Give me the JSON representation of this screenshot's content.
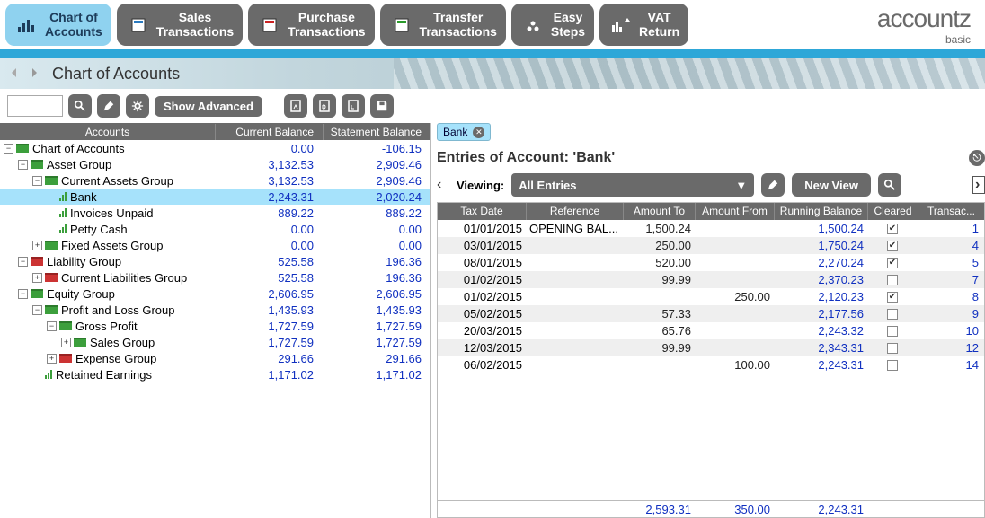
{
  "nav": {
    "items": [
      {
        "label": "Chart of\nAccounts",
        "active": true,
        "icon": "bars"
      },
      {
        "label": "Sales\nTransactions",
        "active": false,
        "icon": "doc-blue"
      },
      {
        "label": "Purchase\nTransactions",
        "active": false,
        "icon": "doc-red"
      },
      {
        "label": "Transfer\nTransactions",
        "active": false,
        "icon": "doc-green"
      },
      {
        "label": "Easy\nSteps",
        "active": false,
        "icon": "steps"
      },
      {
        "label": "VAT\nReturn",
        "active": false,
        "icon": "vat"
      }
    ]
  },
  "brand": {
    "main": "accountz",
    "sub": "basic"
  },
  "header": {
    "title": "Chart of Accounts"
  },
  "toolbar": {
    "show_advanced": "Show Advanced"
  },
  "tree": {
    "headers": {
      "accounts": "Accounts",
      "current": "Current Balance",
      "statement": "Statement Balance"
    },
    "rows": [
      {
        "indent": 0,
        "toggle": "-",
        "icon": "folder-green",
        "name": "Chart of Accounts",
        "current": "0.00",
        "statement": "-106.15"
      },
      {
        "indent": 1,
        "toggle": "-",
        "icon": "folder-green",
        "name": "Asset Group",
        "current": "3,132.53",
        "statement": "2,909.46"
      },
      {
        "indent": 2,
        "toggle": "-",
        "icon": "folder-green",
        "name": "Current Assets Group",
        "current": "3,132.53",
        "statement": "2,909.46"
      },
      {
        "indent": 3,
        "toggle": "",
        "icon": "bars",
        "name": "Bank",
        "current": "2,243.31",
        "statement": "2,020.24",
        "selected": true
      },
      {
        "indent": 3,
        "toggle": "",
        "icon": "bars",
        "name": "Invoices Unpaid",
        "current": "889.22",
        "statement": "889.22"
      },
      {
        "indent": 3,
        "toggle": "",
        "icon": "bars",
        "name": "Petty Cash",
        "current": "0.00",
        "statement": "0.00"
      },
      {
        "indent": 2,
        "toggle": "+",
        "icon": "folder-green",
        "name": "Fixed Assets Group",
        "current": "0.00",
        "statement": "0.00"
      },
      {
        "indent": 1,
        "toggle": "-",
        "icon": "folder-red",
        "name": "Liability Group",
        "current": "525.58",
        "statement": "196.36"
      },
      {
        "indent": 2,
        "toggle": "+",
        "icon": "folder-red",
        "name": "Current Liabilities Group",
        "current": "525.58",
        "statement": "196.36"
      },
      {
        "indent": 1,
        "toggle": "-",
        "icon": "folder-green",
        "name": "Equity Group",
        "current": "2,606.95",
        "statement": "2,606.95"
      },
      {
        "indent": 2,
        "toggle": "-",
        "icon": "folder-green",
        "name": "Profit and Loss Group",
        "current": "1,435.93",
        "statement": "1,435.93"
      },
      {
        "indent": 3,
        "toggle": "-",
        "icon": "folder-green",
        "name": "Gross Profit",
        "current": "1,727.59",
        "statement": "1,727.59"
      },
      {
        "indent": 4,
        "toggle": "+",
        "icon": "folder-green",
        "name": "Sales Group",
        "current": "1,727.59",
        "statement": "1,727.59"
      },
      {
        "indent": 3,
        "toggle": "+",
        "icon": "folder-red",
        "name": "Expense Group",
        "current": "291.66",
        "statement": "291.66"
      },
      {
        "indent": 2,
        "toggle": "",
        "icon": "bars",
        "name": "Retained Earnings",
        "current": "1,171.02",
        "statement": "1,171.02"
      }
    ]
  },
  "right": {
    "tab": "Bank",
    "entries_title_prefix": "Entries of Account:  '",
    "entries_title_account": "Bank",
    "entries_title_suffix": "'",
    "viewing_label": "Viewing:",
    "view_selected": "All Entries",
    "new_view": "New View",
    "grid_headers": {
      "tax": "Tax Date",
      "ref": "Reference",
      "amt_to": "Amount To",
      "amt_from": "Amount From",
      "run": "Running Balance",
      "clr": "Cleared",
      "tr": "Transac..."
    },
    "rows": [
      {
        "tax": "01/01/2015",
        "ref": "OPENING BAL...",
        "amt_to": "1,500.24",
        "amt_from": "",
        "run": "1,500.24",
        "clr": true,
        "tr": "1"
      },
      {
        "tax": "03/01/2015",
        "ref": "",
        "amt_to": "250.00",
        "amt_from": "",
        "run": "1,750.24",
        "clr": true,
        "tr": "4"
      },
      {
        "tax": "08/01/2015",
        "ref": "",
        "amt_to": "520.00",
        "amt_from": "",
        "run": "2,270.24",
        "clr": true,
        "tr": "5"
      },
      {
        "tax": "01/02/2015",
        "ref": "",
        "amt_to": "99.99",
        "amt_from": "",
        "run": "2,370.23",
        "clr": false,
        "tr": "7"
      },
      {
        "tax": "01/02/2015",
        "ref": "",
        "amt_to": "",
        "amt_from": "250.00",
        "run": "2,120.23",
        "clr": true,
        "tr": "8"
      },
      {
        "tax": "05/02/2015",
        "ref": "",
        "amt_to": "57.33",
        "amt_from": "",
        "run": "2,177.56",
        "clr": false,
        "tr": "9"
      },
      {
        "tax": "20/03/2015",
        "ref": "",
        "amt_to": "65.76",
        "amt_from": "",
        "run": "2,243.32",
        "clr": false,
        "tr": "10"
      },
      {
        "tax": "12/03/2015",
        "ref": "",
        "amt_to": "99.99",
        "amt_from": "",
        "run": "2,343.31",
        "clr": false,
        "tr": "12"
      },
      {
        "tax": "06/02/2015",
        "ref": "",
        "amt_to": "",
        "amt_from": "100.00",
        "run": "2,243.31",
        "clr": false,
        "tr": "14"
      }
    ],
    "totals": {
      "amt_to": "2,593.31",
      "amt_from": "350.00",
      "run": "2,243.31"
    }
  }
}
